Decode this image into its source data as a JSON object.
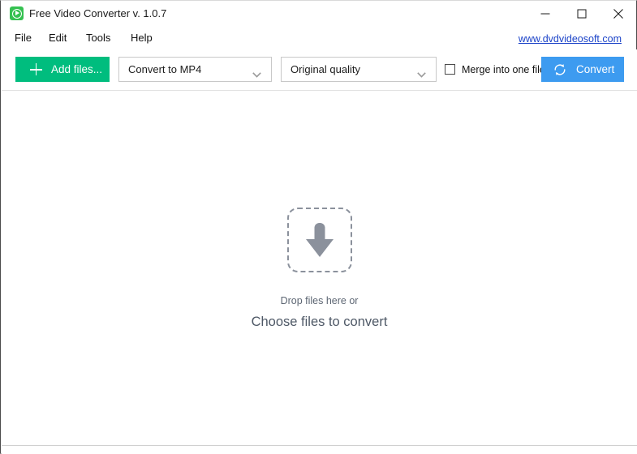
{
  "window": {
    "title": "Free Video Converter v. 1.0.7",
    "app_icon": "play-circle-icon",
    "controls": {
      "minimize": "minimize-icon",
      "maximize": "maximize-icon",
      "close": "close-icon"
    }
  },
  "menu": {
    "items": [
      {
        "label": "File"
      },
      {
        "label": "Edit"
      },
      {
        "label": "Tools"
      },
      {
        "label": "Help"
      }
    ],
    "site_link": "www.dvdvideosoft.com"
  },
  "toolbar": {
    "add_files_label": "Add files...",
    "format_select": {
      "value": "Convert to MP4",
      "chevron": "chevron-down-icon"
    },
    "quality_select": {
      "value": "Original quality",
      "chevron": "chevron-down-icon"
    },
    "merge_checkbox": {
      "label": "Merge into one file",
      "checked": false
    },
    "convert_label": "Convert",
    "convert_icon": "sync-refresh-icon",
    "plus_icon": "plus-icon"
  },
  "drop_area": {
    "icon": "download-arrow-icon",
    "primary_text": "Drop files here or",
    "secondary_text": "Choose files to convert"
  },
  "colors": {
    "accent_green": "#00bd7e",
    "accent_blue": "#3d9bf0",
    "link_blue": "#1b43c8",
    "drop_gray": "#8b919c",
    "text_dark": "#111111",
    "border_gray": "#c8c8c8"
  }
}
